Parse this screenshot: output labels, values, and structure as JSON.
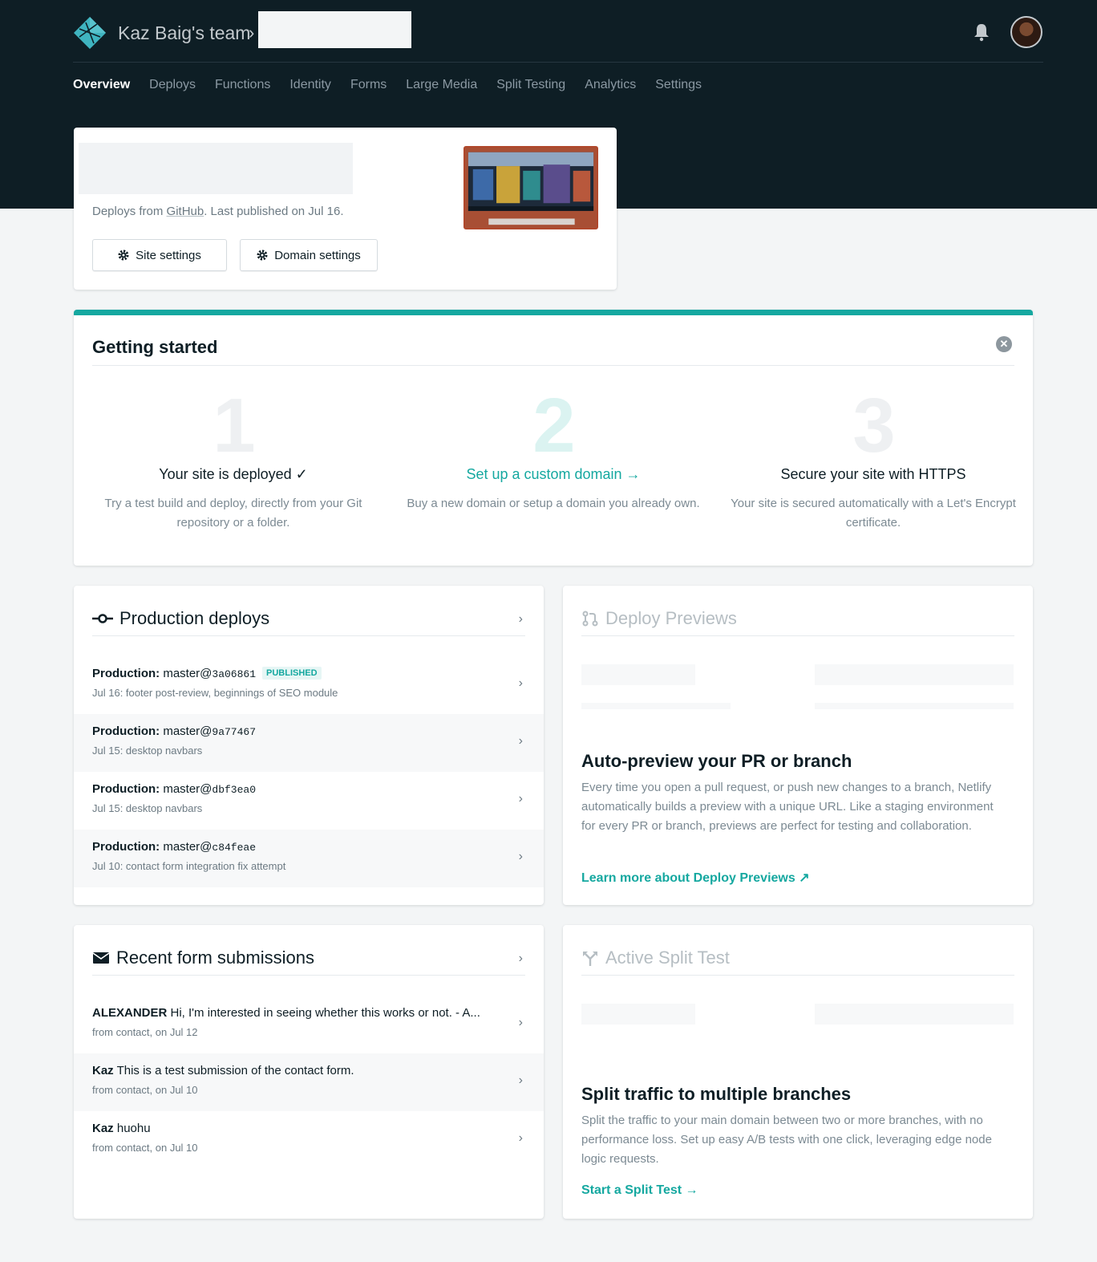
{
  "header": {
    "team_name": "Kaz Baig's team",
    "breadcrumb_separator": "›"
  },
  "nav": {
    "items": [
      "Overview",
      "Deploys",
      "Functions",
      "Identity",
      "Forms",
      "Large Media",
      "Split Testing",
      "Analytics",
      "Settings"
    ],
    "active": "Overview"
  },
  "site": {
    "deploys_from_prefix": "Deploys from ",
    "deploys_from_link": "GitHub",
    "deploys_from_suffix": ". Last published on Jul 16.",
    "site_settings_label": "Site settings",
    "domain_settings_label": "Domain settings"
  },
  "getting_started": {
    "title": "Getting started",
    "steps": [
      {
        "number": "1",
        "heading": "Your site is deployed ✓",
        "body": "Try a test build and deploy, directly from your Git repository or a folder."
      },
      {
        "number": "2",
        "heading": "Set up a custom domain →",
        "body": "Buy a new domain or setup a domain you already own."
      },
      {
        "number": "3",
        "heading": "Secure your site with HTTPS",
        "body": "Your site is secured automatically with a Let's Encrypt certificate."
      }
    ]
  },
  "production_deploys": {
    "title": "Production deploys",
    "rows": [
      {
        "label": "Production:",
        "ref": "master@",
        "sha": "3a06861",
        "badge": "PUBLISHED",
        "message": "Jul 16: footer post-review, beginnings of SEO module"
      },
      {
        "label": "Production:",
        "ref": "master@",
        "sha": "9a77467",
        "badge": "",
        "message": "Jul 15: desktop navbars"
      },
      {
        "label": "Production:",
        "ref": "master@",
        "sha": "dbf3ea0",
        "badge": "",
        "message": "Jul 15: desktop navbars"
      },
      {
        "label": "Production:",
        "ref": "master@",
        "sha": "c84feae",
        "badge": "",
        "message": "Jul 10: contact form integration fix attempt"
      }
    ]
  },
  "deploy_previews": {
    "title": "Deploy Previews",
    "promo_heading": "Auto-preview your PR or branch",
    "promo_body": "Every time you open a pull request, or push new changes to a branch, Netlify automatically builds a preview with a unique URL. Like a staging environment for every PR or branch, previews are perfect for testing and collaboration.",
    "promo_link": "Learn more about Deploy Previews ↗"
  },
  "form_submissions": {
    "title": "Recent form submissions",
    "rows": [
      {
        "name": "ALEXANDER",
        "text": "Hi, I'm interested in seeing whether this works or not. - A...",
        "meta": "from contact, on Jul 12"
      },
      {
        "name": "Kaz",
        "text": "This is a test submission of the contact form.",
        "meta": "from contact, on Jul 10"
      },
      {
        "name": "Kaz",
        "text": "huohu",
        "meta": "from contact, on Jul 10"
      }
    ]
  },
  "split_test": {
    "title": "Active Split Test",
    "promo_heading": "Split traffic to multiple branches",
    "promo_body": "Split the traffic to your main domain between two or more branches, with no performance loss. Set up easy A/B tests with one click, leveraging edge node logic requests.",
    "promo_link": "Start a Split Test →"
  },
  "icons": {
    "logo": "netlify-logo-icon",
    "bell": "bell-icon",
    "gear": "gear-icon",
    "close": "close-circle-icon",
    "deploy": "git-commit-icon",
    "preview": "pull-request-icon",
    "mail": "envelope-icon",
    "split": "branch-split-icon",
    "chevron": "chevron-right-icon"
  },
  "colors": {
    "header_bg": "#0e1e25",
    "accent": "#15a8a0",
    "page_bg": "#f3f5f6"
  }
}
